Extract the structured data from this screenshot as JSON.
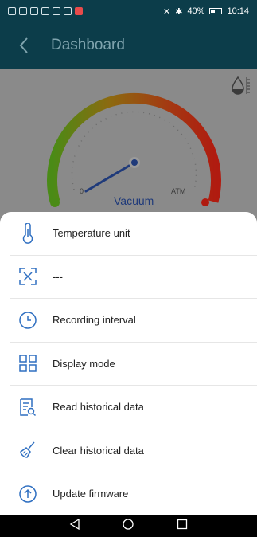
{
  "status_bar": {
    "battery_text": "40%",
    "time": "10:14"
  },
  "app_bar": {
    "title": "Dashboard"
  },
  "gauge": {
    "min_label": "0",
    "max_label": "ATM",
    "unit_label": "Vacuum"
  },
  "menu": {
    "items": [
      {
        "label": "Temperature unit",
        "icon": "thermometer-icon"
      },
      {
        "label": "---",
        "icon": "expand-frame-icon"
      },
      {
        "label": "Recording interval",
        "icon": "clock-icon"
      },
      {
        "label": "Display mode",
        "icon": "grid-icon"
      },
      {
        "label": "Read historical data",
        "icon": "document-search-icon"
      },
      {
        "label": "Clear historical data",
        "icon": "broom-icon"
      },
      {
        "label": "Update firmware",
        "icon": "upload-arrow-icon"
      }
    ]
  },
  "colors": {
    "header": "#0c3d4a",
    "accent_blue": "#2f6fc1",
    "overlay": "#8a8a8a"
  }
}
